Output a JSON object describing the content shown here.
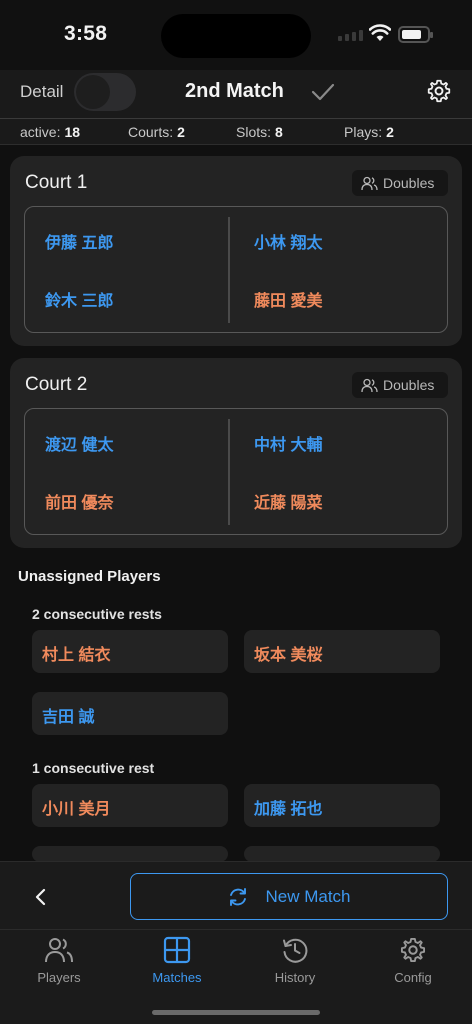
{
  "status": {
    "time": "3:58"
  },
  "header": {
    "detail_label": "Detail",
    "title": "2nd Match"
  },
  "stats": [
    {
      "label": "active:",
      "value": "18"
    },
    {
      "label": "Courts:",
      "value": "2"
    },
    {
      "label": "Slots:",
      "value": "8"
    },
    {
      "label": "Plays:",
      "value": "2"
    }
  ],
  "courts": [
    {
      "title": "Court 1",
      "mode": "Doubles",
      "left": [
        {
          "name": "伊藤 五郎",
          "color": "#3d98f0"
        },
        {
          "name": "鈴木 三郎",
          "color": "#3d98f0"
        }
      ],
      "right": [
        {
          "name": "小林 翔太",
          "color": "#3d98f0"
        },
        {
          "name": "藤田 愛美",
          "color": "#f08a5c"
        }
      ]
    },
    {
      "title": "Court 2",
      "mode": "Doubles",
      "left": [
        {
          "name": "渡辺 健太",
          "color": "#3d98f0"
        },
        {
          "name": "前田 優奈",
          "color": "#f08a5c"
        }
      ],
      "right": [
        {
          "name": "中村 大輔",
          "color": "#3d98f0"
        },
        {
          "name": "近藤 陽菜",
          "color": "#f08a5c"
        }
      ]
    }
  ],
  "unassigned": {
    "title": "Unassigned Players",
    "groups": [
      {
        "label": "2 consecutive rests",
        "players": [
          "村上 結衣",
          "坂本 美桜",
          "吉田 誠"
        ]
      },
      {
        "label": "1 consecutive rest",
        "players": [
          "小川 美月",
          "加藤 拓也"
        ]
      }
    ]
  },
  "actions": {
    "new_match_label": "New Match"
  },
  "tabs": [
    {
      "label": "Players",
      "icon": "users-icon"
    },
    {
      "label": "Matches",
      "icon": "grid-icon",
      "active": true
    },
    {
      "label": "History",
      "icon": "history-icon"
    },
    {
      "label": "Config",
      "icon": "gear-icon"
    }
  ],
  "colors": {
    "accent": "#3d98f0",
    "female": "#f08a5c",
    "background": "#101010",
    "card": "#232323"
  }
}
